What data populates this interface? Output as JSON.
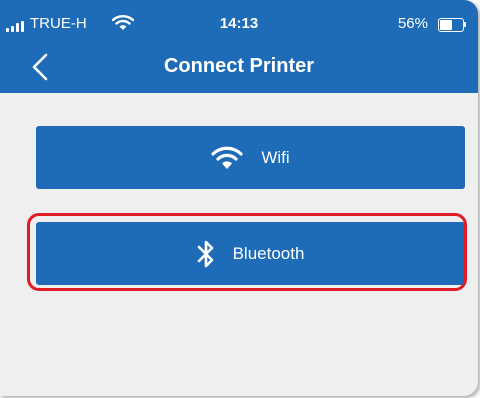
{
  "status_bar": {
    "carrier": "TRUE-H",
    "time": "14:13",
    "battery_percent": "56%",
    "battery_level": 0.56
  },
  "header": {
    "title": "Connect Printer",
    "back_icon": "chevron-left-icon"
  },
  "options": {
    "wifi_label": "Wifi",
    "wifi_icon": "wifi-icon",
    "bluetooth_label": "Bluetooth",
    "bluetooth_icon": "bluetooth-icon"
  },
  "colors": {
    "primary": "#1e6bb8",
    "background": "#efeff0",
    "highlight": "#e01b24"
  }
}
